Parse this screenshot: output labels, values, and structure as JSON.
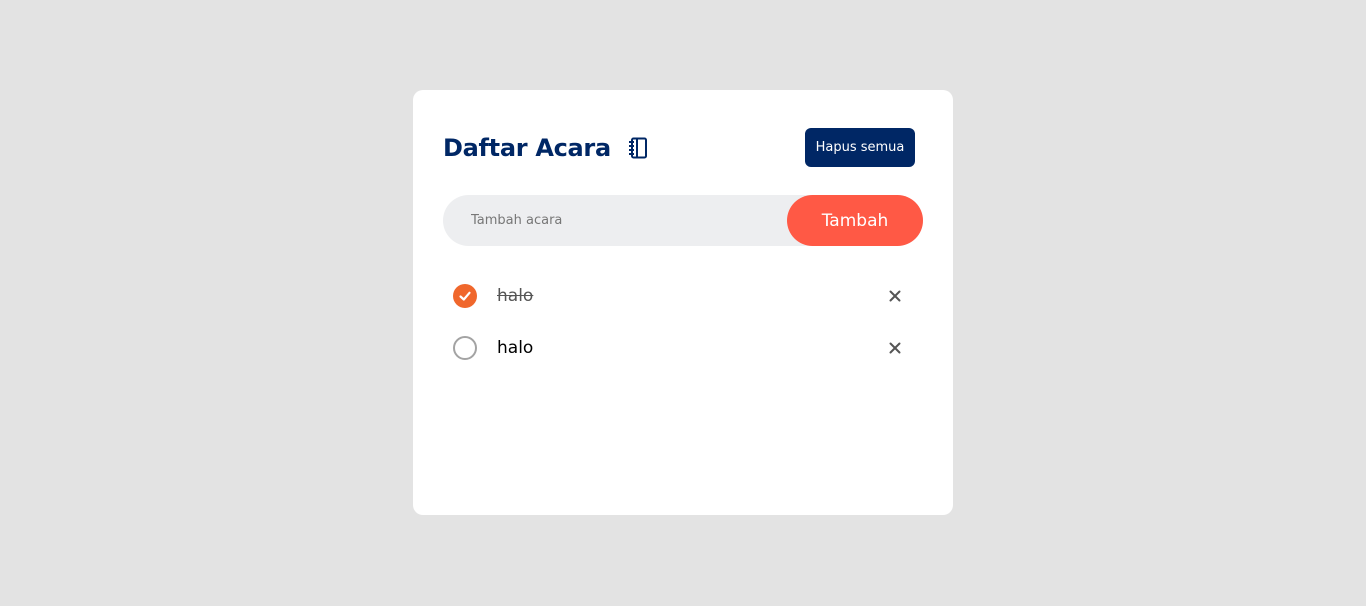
{
  "header": {
    "title": "Daftar Acara",
    "title_icon": "notebook-icon",
    "clear_all_label": "Hapus semua"
  },
  "add_form": {
    "placeholder": "Tambah acara",
    "value": "",
    "add_label": "Tambah"
  },
  "items": [
    {
      "text": "halo",
      "checked": true
    },
    {
      "text": "halo",
      "checked": false
    }
  ],
  "colors": {
    "background": "#e3e3e3",
    "card": "#ffffff",
    "primary": "#002765",
    "accent": "#ff5945",
    "check_done": "#f0672c",
    "input_bg": "#edeef0"
  }
}
